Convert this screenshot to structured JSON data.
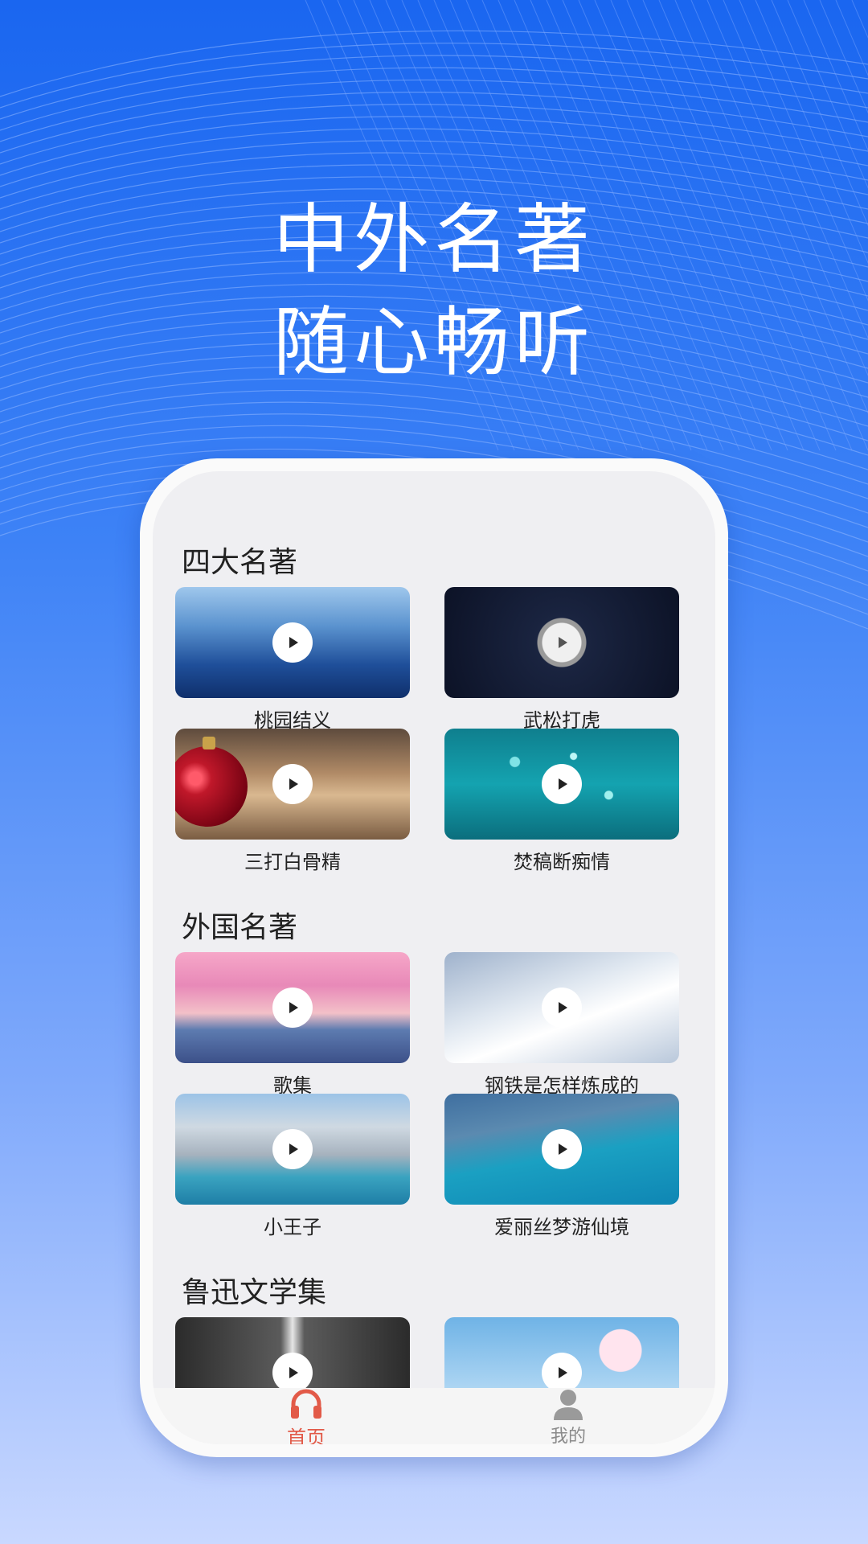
{
  "headline": {
    "line1": "中外名著",
    "line2": "随心畅听"
  },
  "sections": [
    {
      "title": "四大名著",
      "items": [
        {
          "label": "桃园结义",
          "scene": "mountain"
        },
        {
          "label": "武松打虎",
          "scene": "moon"
        },
        {
          "label": "三打白骨精",
          "scene": "ornament"
        },
        {
          "label": "焚稿断痴情",
          "scene": "water"
        }
      ]
    },
    {
      "title": "外国名著",
      "items": [
        {
          "label": "歌集",
          "scene": "sunset"
        },
        {
          "label": "钢铁是怎样炼成的",
          "scene": "satellite"
        },
        {
          "label": "小王子",
          "scene": "city"
        },
        {
          "label": "爱丽丝梦游仙境",
          "scene": "coast"
        }
      ]
    },
    {
      "title": "鲁迅文学集",
      "items": [
        {
          "label": "",
          "scene": "rock"
        },
        {
          "label": "",
          "scene": "blossom"
        }
      ]
    }
  ],
  "tabbar": {
    "home": "首页",
    "mine": "我的",
    "home_icon": "headphones-icon",
    "mine_icon": "user-icon"
  },
  "colors": {
    "accent": "#e25a48",
    "bg_top": "#1a66f0",
    "bg_bottom": "#c9d8ff"
  }
}
